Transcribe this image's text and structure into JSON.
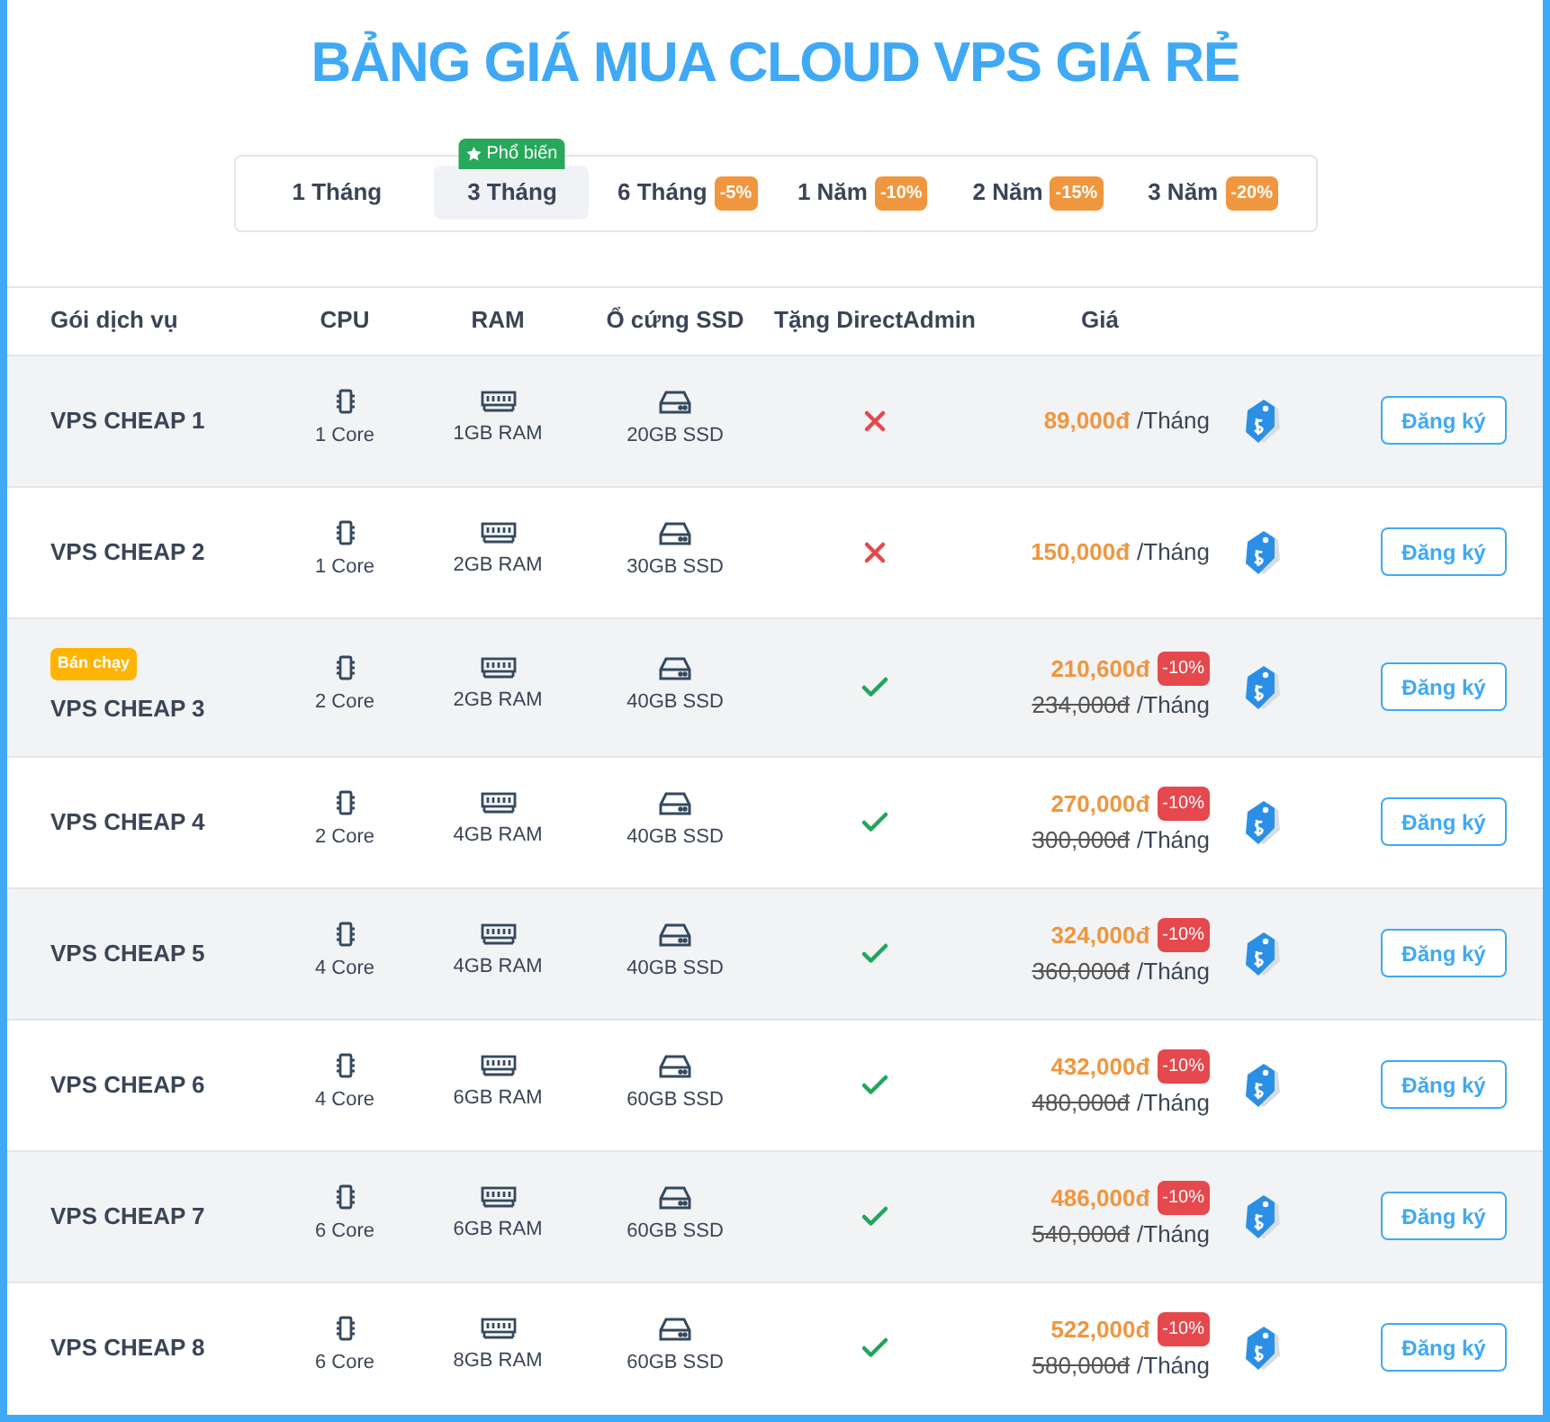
{
  "title": "BẢNG GIÁ MUA CLOUD VPS GIÁ RẺ",
  "tabs": [
    {
      "label": "1 Tháng",
      "selected": false
    },
    {
      "label": "3 Tháng",
      "selected": true,
      "badge": "Phổ biến"
    },
    {
      "label": "6 Tháng",
      "selected": false,
      "discount": "-5%"
    },
    {
      "label": "1 Năm",
      "selected": false,
      "discount": "-10%"
    },
    {
      "label": "2 Năm",
      "selected": false,
      "discount": "-15%"
    },
    {
      "label": "3 Năm",
      "selected": false,
      "discount": "-20%"
    }
  ],
  "table": {
    "columns": [
      "Gói dịch vụ",
      "CPU",
      "RAM",
      "Ổ cứng SSD",
      "Tặng DirectAdmin",
      "Giá"
    ],
    "rows": [
      {
        "name": "VPS CHEAP 1",
        "cpu": "1 Core",
        "ram": "1GB RAM",
        "ssd": "20GB SSD",
        "directadmin": false,
        "price": "89,000đ",
        "unit": "/Tháng",
        "button": "Đăng ký"
      },
      {
        "name": "VPS CHEAP 2",
        "cpu": "1 Core",
        "ram": "2GB RAM",
        "ssd": "30GB SSD",
        "directadmin": false,
        "price": "150,000đ",
        "unit": "/Tháng",
        "button": "Đăng ký"
      },
      {
        "name": "VPS CHEAP 3",
        "badge": "Bán chạy",
        "cpu": "2 Core",
        "ram": "2GB RAM",
        "ssd": "40GB SSD",
        "directadmin": true,
        "price": "210,600đ",
        "discount": "-10%",
        "old_price": "234,000đ",
        "unit": "/Tháng",
        "button": "Đăng ký"
      },
      {
        "name": "VPS CHEAP 4",
        "cpu": "2 Core",
        "ram": "4GB RAM",
        "ssd": "40GB SSD",
        "directadmin": true,
        "price": "270,000đ",
        "discount": "-10%",
        "old_price": "300,000đ",
        "unit": "/Tháng",
        "button": "Đăng ký"
      },
      {
        "name": "VPS CHEAP 5",
        "cpu": "4 Core",
        "ram": "4GB RAM",
        "ssd": "40GB SSD",
        "directadmin": true,
        "price": "324,000đ",
        "discount": "-10%",
        "old_price": "360,000đ",
        "unit": "/Tháng",
        "button": "Đăng ký"
      },
      {
        "name": "VPS CHEAP 6",
        "cpu": "4 Core",
        "ram": "6GB RAM",
        "ssd": "60GB SSD",
        "directadmin": true,
        "price": "432,000đ",
        "discount": "-10%",
        "old_price": "480,000đ",
        "unit": "/Tháng",
        "button": "Đăng ký"
      },
      {
        "name": "VPS CHEAP 7",
        "cpu": "6 Core",
        "ram": "6GB RAM",
        "ssd": "60GB SSD",
        "directadmin": true,
        "price": "486,000đ",
        "discount": "-10%",
        "old_price": "540,000đ",
        "unit": "/Tháng",
        "button": "Đăng ký"
      },
      {
        "name": "VPS CHEAP 8",
        "cpu": "6 Core",
        "ram": "8GB RAM",
        "ssd": "60GB SSD",
        "directadmin": true,
        "price": "522,000đ",
        "discount": "-10%",
        "old_price": "580,000đ",
        "unit": "/Tháng",
        "button": "Đăng ký"
      }
    ]
  }
}
